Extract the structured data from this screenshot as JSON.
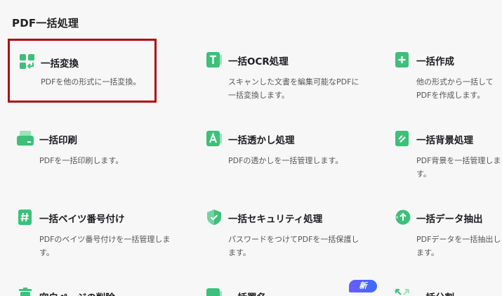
{
  "page": {
    "title": "PDF一括処理"
  },
  "cards": [
    {
      "title": "一括変換",
      "desc": "PDFを他の形式に一括変換。"
    },
    {
      "title": "一括OCR処理",
      "desc": "スキャンした文書を編集可能なPDFに一括変換します。"
    },
    {
      "title": "一括作成",
      "desc": "他の形式から一括してPDFを作成します。"
    },
    {
      "title": "一括印刷",
      "desc": "PDFを一括印刷します。"
    },
    {
      "title": "一括透かし処理",
      "desc": "PDFの透かしを一括管理します。"
    },
    {
      "title": "一括背景処理",
      "desc": "PDF背景を一括管理します。"
    },
    {
      "title": "一括ベイツ番号付け",
      "desc": "PDFのベイツ番号付けを一括管理します。"
    },
    {
      "title": "一括セキュリティ処理",
      "desc": "パスワードをつけてPDFを一括保護します。"
    },
    {
      "title": "一括データ抽出",
      "desc": "PDFデータを一括抽出します。"
    },
    {
      "title": "空白ページの削除",
      "desc": ""
    },
    {
      "title": "一括署名",
      "desc": ""
    },
    {
      "title": "一括分割",
      "desc": ""
    }
  ],
  "badge": {
    "label": "新"
  },
  "colors": {
    "accent": "#3cc07a",
    "highlight": "#b00d0d",
    "badge": "#5b62ff"
  }
}
